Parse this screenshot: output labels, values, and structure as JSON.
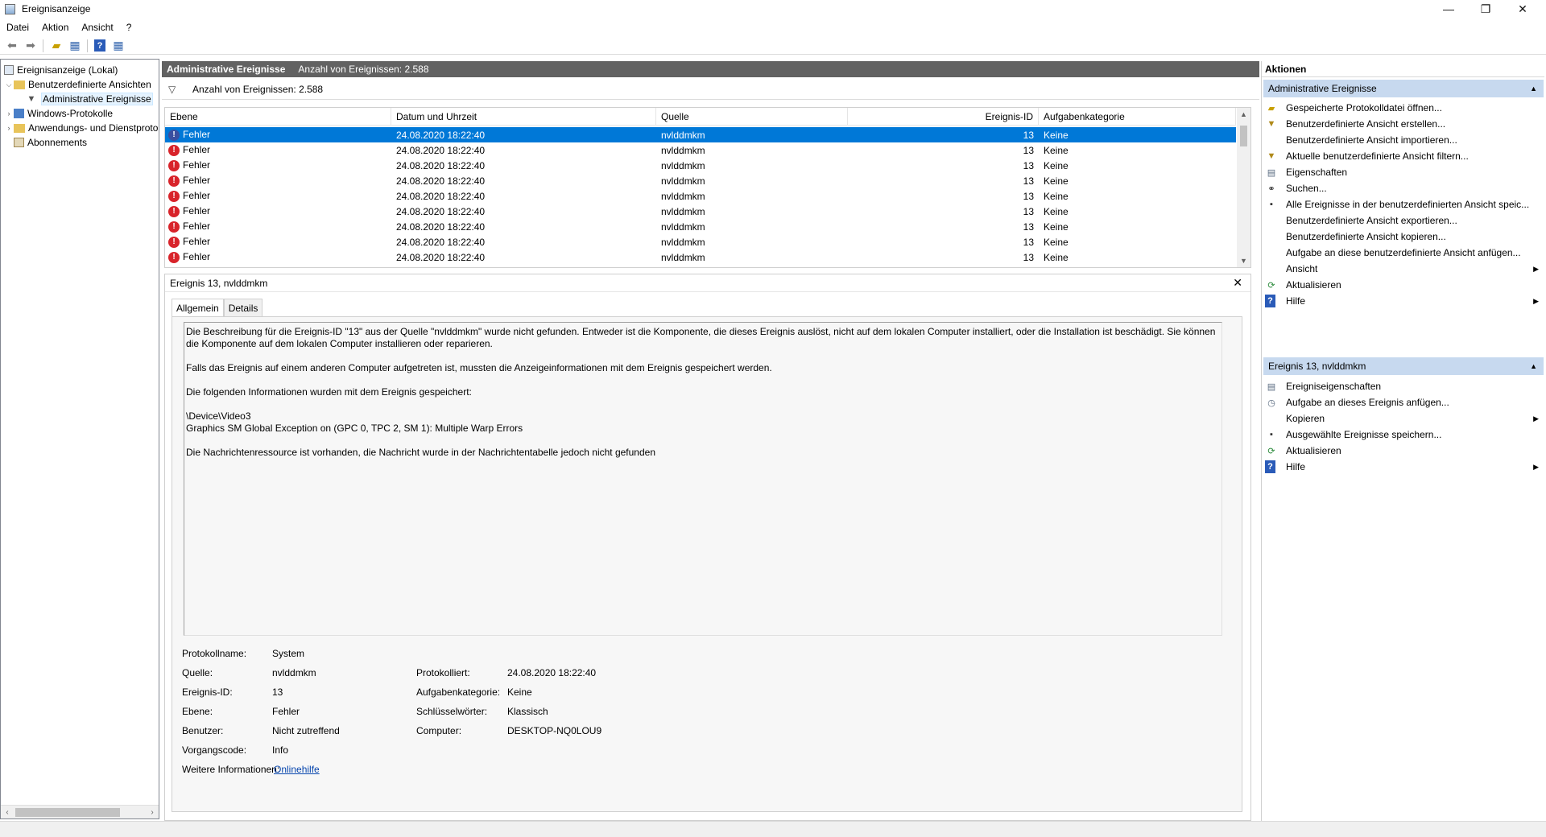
{
  "window": {
    "title": "Ereignisanzeige",
    "minimize": "—",
    "restore": "❐",
    "close": "✕"
  },
  "menu": [
    "Datei",
    "Aktion",
    "Ansicht",
    "?"
  ],
  "tree": {
    "root": "Ereignisanzeige (Lokal)",
    "custom_views": "Benutzerdefinierte Ansichten",
    "admin_events": "Administrative Ereignisse",
    "windows_logs": "Windows-Protokolle",
    "app_service_logs": "Anwendungs- und Dienstprotokolle",
    "subscriptions": "Abonnements"
  },
  "center": {
    "header_title": "Administrative Ereignisse",
    "header_count": "Anzahl von Ereignissen: 2.588",
    "filter_text": "Anzahl von Ereignissen: 2.588",
    "columns": [
      "Ebene",
      "Datum und Uhrzeit",
      "Quelle",
      "Ereignis-ID",
      "Aufgabenkategorie"
    ],
    "rows": [
      {
        "level": "Fehler",
        "date": "24.08.2020 18:22:40",
        "source": "nvlddmkm",
        "id": "13",
        "category": "Keine"
      },
      {
        "level": "Fehler",
        "date": "24.08.2020 18:22:40",
        "source": "nvlddmkm",
        "id": "13",
        "category": "Keine"
      },
      {
        "level": "Fehler",
        "date": "24.08.2020 18:22:40",
        "source": "nvlddmkm",
        "id": "13",
        "category": "Keine"
      },
      {
        "level": "Fehler",
        "date": "24.08.2020 18:22:40",
        "source": "nvlddmkm",
        "id": "13",
        "category": "Keine"
      },
      {
        "level": "Fehler",
        "date": "24.08.2020 18:22:40",
        "source": "nvlddmkm",
        "id": "13",
        "category": "Keine"
      },
      {
        "level": "Fehler",
        "date": "24.08.2020 18:22:40",
        "source": "nvlddmkm",
        "id": "13",
        "category": "Keine"
      },
      {
        "level": "Fehler",
        "date": "24.08.2020 18:22:40",
        "source": "nvlddmkm",
        "id": "13",
        "category": "Keine"
      },
      {
        "level": "Fehler",
        "date": "24.08.2020 18:22:40",
        "source": "nvlddmkm",
        "id": "13",
        "category": "Keine"
      },
      {
        "level": "Fehler",
        "date": "24.08.2020 18:22:40",
        "source": "nvlddmkm",
        "id": "13",
        "category": "Keine"
      }
    ]
  },
  "detail": {
    "title": "Ereignis 13, nvlddmkm",
    "close": "✕",
    "tabs": [
      "Allgemein",
      "Details"
    ],
    "description": [
      "Die Beschreibung für die Ereignis-ID \"13\" aus der Quelle \"nvlddmkm\" wurde nicht gefunden. Entweder ist die Komponente, die dieses Ereignis auslöst, nicht auf dem lokalen Computer installiert, oder die Installation ist beschädigt. Sie können die Komponente auf dem lokalen Computer installieren oder reparieren.",
      "Falls das Ereignis auf einem anderen Computer aufgetreten ist, mussten die Anzeigeinformationen mit dem Ereignis gespeichert werden.",
      "Die folgenden Informationen wurden mit dem Ereignis gespeichert:",
      "\\Device\\Video3",
      "Graphics SM Global Exception on (GPC 0, TPC 2, SM 1): Multiple Warp Errors",
      "Die Nachrichtenressource ist vorhanden, die Nachricht wurde in der Nachrichtentabelle jedoch nicht gefunden"
    ],
    "props": {
      "log_name_label": "Protokollname:",
      "log_name": "System",
      "source_label": "Quelle:",
      "source": "nvlddmkm",
      "logged_label": "Protokolliert:",
      "logged": "24.08.2020 18:22:40",
      "event_id_label": "Ereignis-ID:",
      "event_id": "13",
      "task_cat_label": "Aufgabenkategorie:",
      "task_cat": "Keine",
      "level_label": "Ebene:",
      "level": "Fehler",
      "keywords_label": "Schlüsselwörter:",
      "keywords": "Klassisch",
      "user_label": "Benutzer:",
      "user": "Nicht zutreffend",
      "computer_label": "Computer:",
      "computer": "DESKTOP-NQ0LOU9",
      "opcode_label": "Vorgangscode:",
      "opcode": "Info",
      "more_info_label": "Weitere Informationen:",
      "more_info": "Onlinehilfe"
    }
  },
  "actions": {
    "title": "Aktionen",
    "section1": "Administrative Ereignisse",
    "items1": [
      {
        "label": "Gespeicherte Protokolldatei öffnen...",
        "icon": "folder-icon"
      },
      {
        "label": "Benutzerdefinierte Ansicht erstellen...",
        "icon": "filter-icon"
      },
      {
        "label": "Benutzerdefinierte Ansicht importieren...",
        "icon": ""
      },
      {
        "label": "Aktuelle benutzerdefinierte Ansicht filtern...",
        "icon": "filter-icon"
      },
      {
        "label": "Eigenschaften",
        "icon": "properties-icon"
      },
      {
        "label": "Suchen...",
        "icon": "binoculars-icon"
      },
      {
        "label": "Alle Ereignisse in der benutzerdefinierten Ansicht speic...",
        "icon": "save-icon"
      },
      {
        "label": "Benutzerdefinierte Ansicht exportieren...",
        "icon": ""
      },
      {
        "label": "Benutzerdefinierte Ansicht kopieren...",
        "icon": ""
      },
      {
        "label": "Aufgabe an diese benutzerdefinierte Ansicht anfügen...",
        "icon": ""
      },
      {
        "label": "Ansicht",
        "icon": ""
      },
      {
        "label": "Aktualisieren",
        "icon": "refresh-icon"
      },
      {
        "label": "Hilfe",
        "icon": "help-icon"
      }
    ],
    "section2": "Ereignis 13, nvlddmkm",
    "items2": [
      {
        "label": "Ereigniseigenschaften",
        "icon": "properties-icon"
      },
      {
        "label": "Aufgabe an dieses Ereignis anfügen...",
        "icon": "task-icon"
      },
      {
        "label": "Kopieren",
        "icon": ""
      },
      {
        "label": "Ausgewählte Ereignisse speichern...",
        "icon": "save-icon"
      },
      {
        "label": "Aktualisieren",
        "icon": "refresh-icon"
      },
      {
        "label": "Hilfe",
        "icon": "help-icon"
      }
    ]
  }
}
